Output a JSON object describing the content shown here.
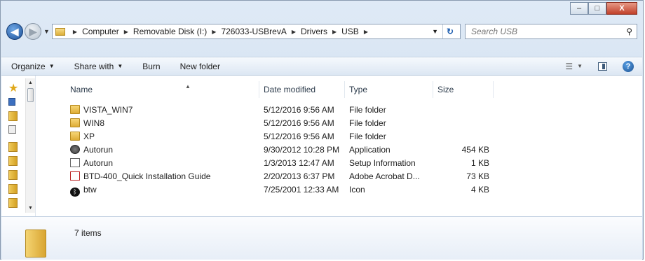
{
  "window_controls": {
    "minimize": "▭",
    "maximize": "□",
    "close": "X"
  },
  "address_bar": {
    "crumbs": [
      "Computer",
      "Removable Disk (I:)",
      "726033-USBrevA",
      "Drivers",
      "USB"
    ]
  },
  "search": {
    "placeholder": "Search USB"
  },
  "toolbar": {
    "organize": "Organize",
    "share_with": "Share with",
    "burn": "Burn",
    "new_folder": "New folder"
  },
  "columns": {
    "name": "Name",
    "date": "Date modified",
    "type": "Type",
    "size": "Size"
  },
  "files": [
    {
      "name": "VISTA_WIN7",
      "date": "5/12/2016 9:56 AM",
      "type": "File folder",
      "size": "",
      "icon": "folder-icon"
    },
    {
      "name": "WIN8",
      "date": "5/12/2016 9:56 AM",
      "type": "File folder",
      "size": "",
      "icon": "folder-icon"
    },
    {
      "name": "XP",
      "date": "5/12/2016 9:56 AM",
      "type": "File folder",
      "size": "",
      "icon": "folder-icon"
    },
    {
      "name": "Autorun",
      "date": "9/30/2012 10:28 PM",
      "type": "Application",
      "size": "454 KB",
      "icon": "application-icon"
    },
    {
      "name": "Autorun",
      "date": "1/3/2013 12:47 AM",
      "type": "Setup Information",
      "size": "1 KB",
      "icon": "setup-information-icon"
    },
    {
      "name": "BTD-400_Quick Installation Guide",
      "date": "2/20/2013 6:37 PM",
      "type": "Adobe Acrobat D...",
      "size": "73 KB",
      "icon": "pdf-icon"
    },
    {
      "name": "btw",
      "date": "7/25/2001 12:33 AM",
      "type": "Icon",
      "size": "4 KB",
      "icon": "bluetooth-icon"
    }
  ],
  "status": {
    "item_count": "7 items"
  }
}
